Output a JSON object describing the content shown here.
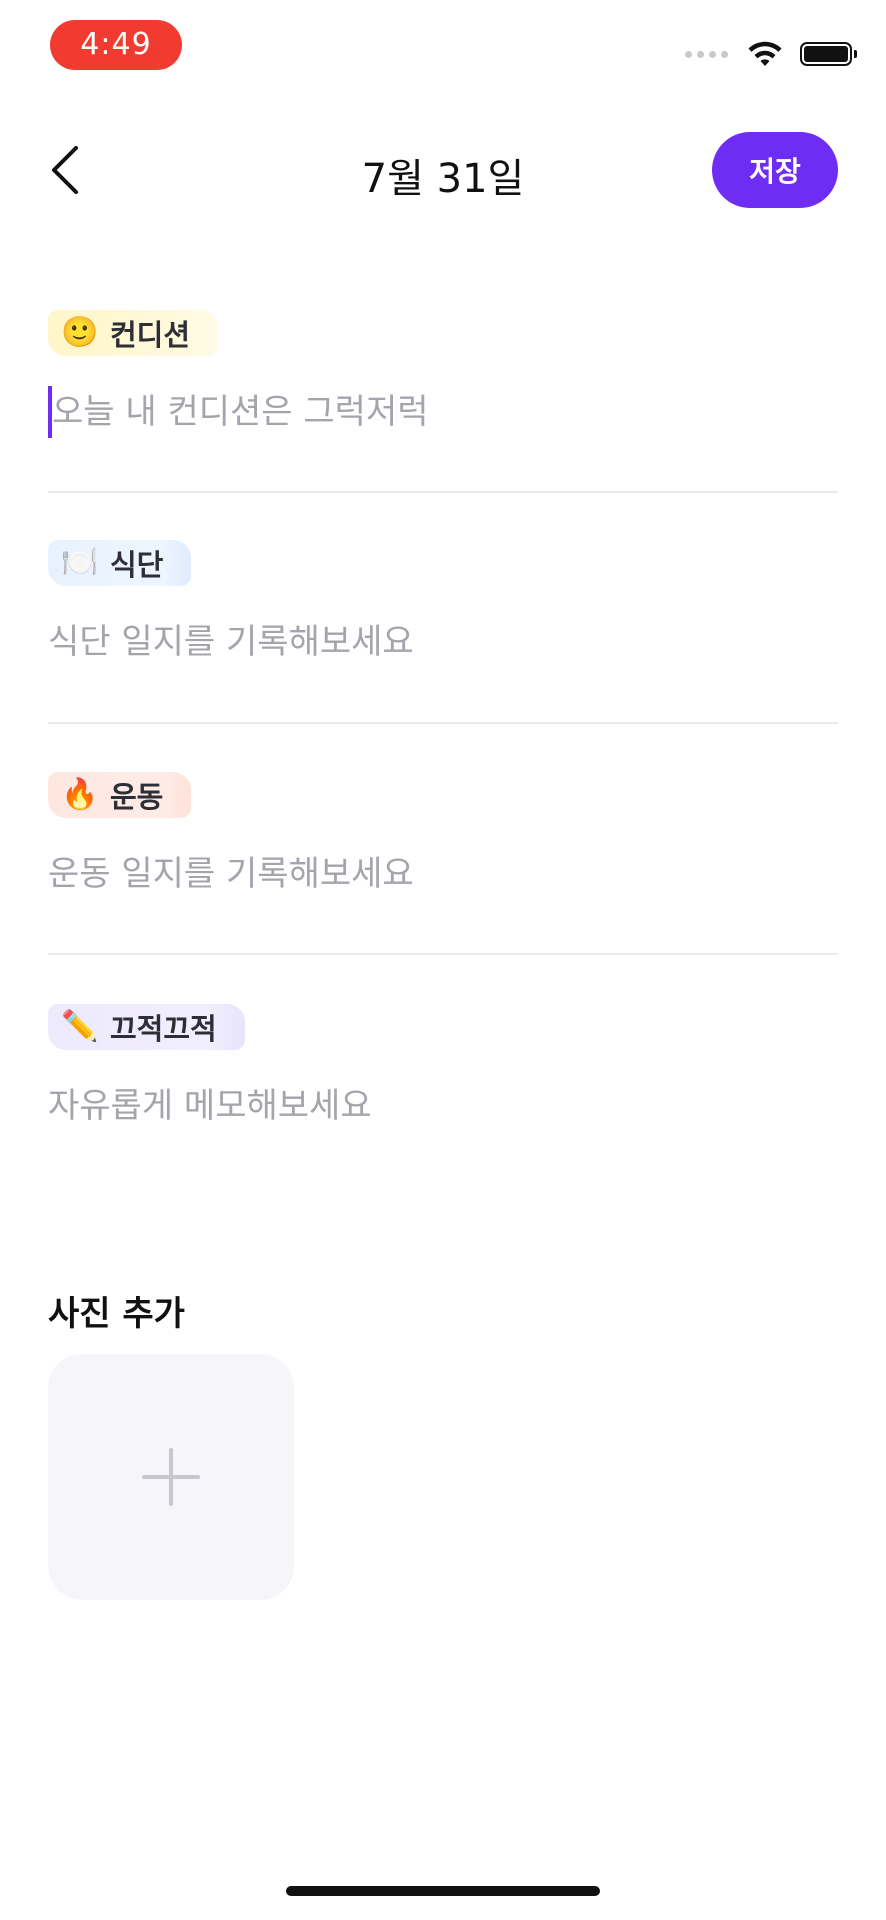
{
  "status_bar": {
    "time": "4:49"
  },
  "header": {
    "title": "7월 31일",
    "save_label": "저장"
  },
  "sections": [
    {
      "tag": "컨디션",
      "emoji": "🙂",
      "placeholder": "오늘 내 컨디션은 그럭저럭",
      "color": "#fff6c8"
    },
    {
      "tag": "식단",
      "emoji": "🍽️",
      "placeholder": "식단 일지를 기록해보세요",
      "color": "#e8f2ff"
    },
    {
      "tag": "운동",
      "emoji": "🔥",
      "placeholder": "운동 일지를 기록해보세요",
      "color": "#ffe7e0"
    },
    {
      "tag": "끄적끄적",
      "emoji": "✏️",
      "placeholder": "자유롭게 메모해보세요",
      "color": "#eeeafd"
    }
  ],
  "photo": {
    "title": "사진 추가"
  },
  "accent": "#6f2cf3"
}
